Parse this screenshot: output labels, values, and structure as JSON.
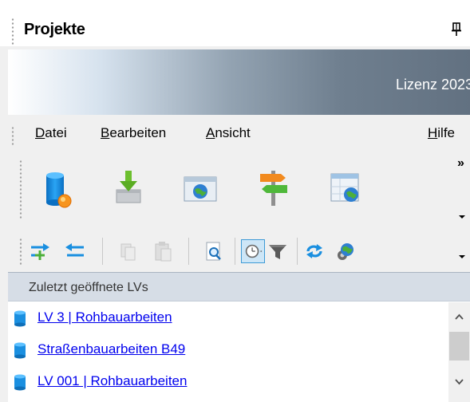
{
  "panel": {
    "title": "Projekte",
    "pin_icon": "pin-icon"
  },
  "banner": {
    "text": "Lizenz 2023"
  },
  "menu": {
    "items": [
      {
        "underline": "D",
        "rest": "atei"
      },
      {
        "underline": "B",
        "rest": "earbeiten"
      },
      {
        "underline": "A",
        "rest": "nsicht"
      },
      {
        "underline": "H",
        "rest": "ilfe"
      }
    ]
  },
  "toolbar_big": {
    "overflow": "»",
    "buttons": [
      {
        "icon": "new-database-icon"
      },
      {
        "icon": "import-download-icon"
      },
      {
        "icon": "web-window-icon"
      },
      {
        "icon": "signpost-icon"
      },
      {
        "icon": "table-globe-icon"
      }
    ]
  },
  "toolbar_small": {
    "buttons": [
      {
        "icon": "indent-right-icon"
      },
      {
        "icon": "indent-left-icon"
      },
      {
        "icon": "copy-disabled-icon"
      },
      {
        "icon": "paste-disabled-icon"
      },
      {
        "icon": "preview-magnifier-icon"
      },
      {
        "icon": "clock-history-icon",
        "active": true
      },
      {
        "icon": "filter-icon"
      },
      {
        "icon": "refresh-icon"
      },
      {
        "icon": "globe-gear-icon"
      }
    ]
  },
  "recent": {
    "header": "Zuletzt geöffnete LVs",
    "items": [
      {
        "label": "LV 3 | Rohbauarbeiten"
      },
      {
        "label": "Straßenbauarbeiten B49"
      },
      {
        "label": "LV 001 | Rohbauarbeiten"
      }
    ]
  },
  "colors": {
    "link": "#0000ee",
    "accent": "#1a8fe0",
    "header_bg": "#d6dde6"
  }
}
